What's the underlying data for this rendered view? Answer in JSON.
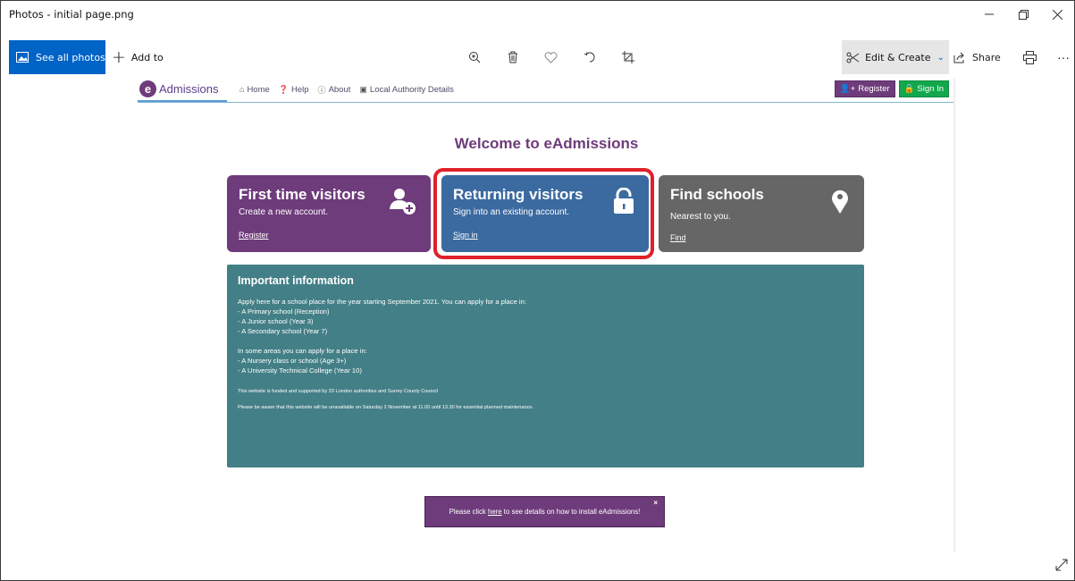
{
  "app": {
    "window_title": "Photos - initial page.png",
    "see_all_photos": "See all photos",
    "add_to": "Add to",
    "edit_create": "Edit & Create",
    "share": "Share"
  },
  "site": {
    "logo_letter": "e",
    "logo_text": "Admissions",
    "nav": [
      "Home",
      "Help",
      "About",
      "Local Authority Details"
    ],
    "register_btn": "Register",
    "sign_in_btn": "Sign In",
    "welcome": "Welcome to eAdmissions",
    "cards": [
      {
        "title": "First time visitors",
        "subtitle": "Create a new account.",
        "link": "Register",
        "color": "#6e3b7b",
        "icon": "add-user-icon"
      },
      {
        "title": "Returning visitors",
        "subtitle": "Sign into an existing account.",
        "link": "Sign in",
        "color": "#3b6aa0",
        "icon": "lock-icon"
      },
      {
        "title": "Find schools",
        "subtitle": "Nearest to you.",
        "link": "Find",
        "color": "#666666",
        "icon": "map-marker-icon"
      }
    ],
    "info": {
      "title": "Important information",
      "lines": [
        "Apply here for a school place for the year starting September 2021. You can apply for a place in:",
        "- A Primary school (Reception)",
        "- A Junior school (Year 3)",
        "- A Secondary school (Year 7)",
        "In some areas you can apply for a place in:",
        "- A Nursery class or school (Age 3+)",
        "- A University Technical College (Year 10)"
      ],
      "funded": "This website is funded and supported by 33 London authorities and Surrey County Council",
      "maintenance": "Please be aware that this website will be unavailable on Saturday 2 November at 11.00 until 13.30 for essential planned maintenance."
    },
    "banner": {
      "pre": "Please click ",
      "link": "here",
      "post": " to see details on how to install eAdmissions!",
      "close": "×"
    }
  },
  "colors": {
    "accent_blue": "#0063c6",
    "purple": "#6e3b7b",
    "highlight_red": "#e0202a",
    "teal": "#437f86",
    "green": "#13a84e"
  }
}
